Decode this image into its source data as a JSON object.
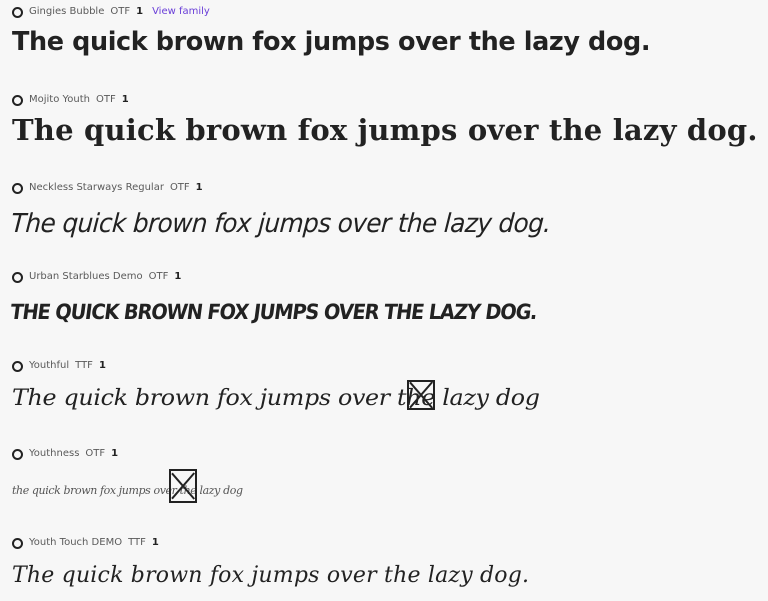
{
  "view_family_label": "View family",
  "fonts": [
    {
      "name": "Gingies Bubble",
      "format": "OTF",
      "count": "1",
      "preview": "The quick brown fox jumps over the lazy dog."
    },
    {
      "name": "Mojito Youth",
      "format": "OTF",
      "count": "1",
      "preview": "The quick brown fox jumps over the lazy dog."
    },
    {
      "name": "Neckless Starways Regular",
      "format": "OTF",
      "count": "1",
      "preview": "The quick brown fox jumps over the lazy dog."
    },
    {
      "name": "Urban Starblues Demo",
      "format": "OTF",
      "count": "1",
      "preview": "The quick brown fox jumps over the lazy dog."
    },
    {
      "name": "Youthful",
      "format": "TTF",
      "count": "1",
      "preview": "The quick brown fox jumps over the lazy dog",
      "missing_glyph_icon": "missing-glyph"
    },
    {
      "name": "Youthness",
      "format": "OTF",
      "count": "1",
      "preview": "the quick brown fox jumps over the lazy dog",
      "missing_glyph_icon": "missing-glyph"
    },
    {
      "name": "Youth Touch DEMO",
      "format": "TTF",
      "count": "1",
      "preview": "The quick brown fox jumps over the lazy dog."
    }
  ]
}
